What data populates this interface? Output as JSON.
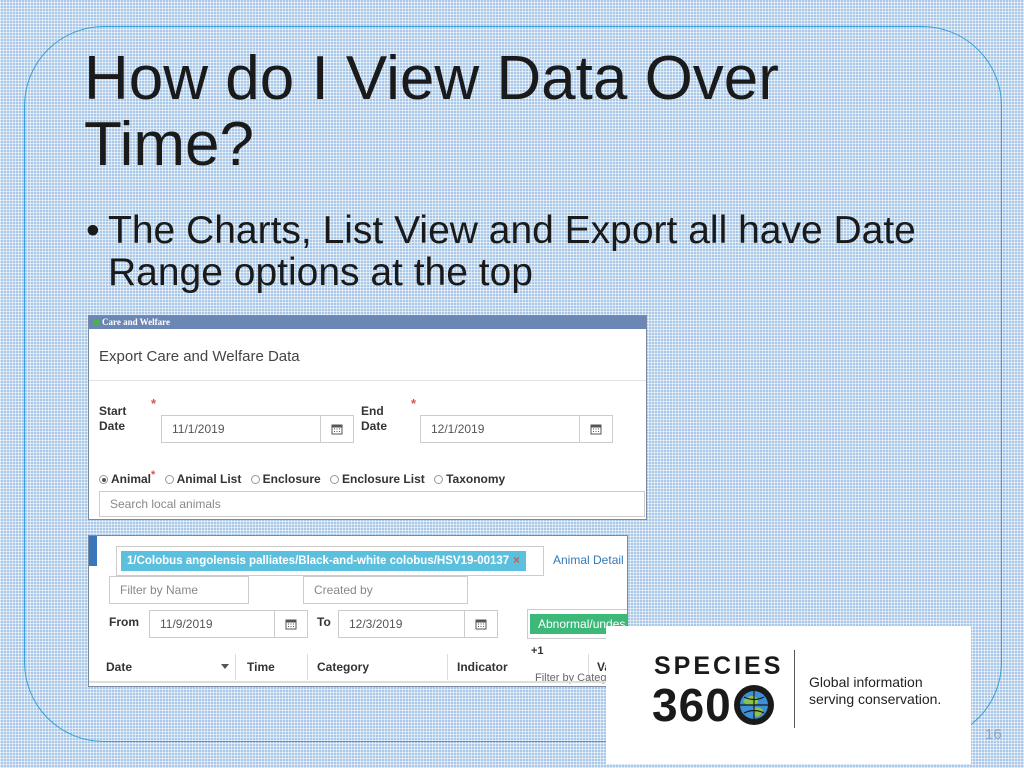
{
  "slide": {
    "title": "How do I View Data Over Time?",
    "bullet": "The Charts, List View and Export all have Date Range options at the top",
    "bullet_char": "•",
    "page_number": "16"
  },
  "export_panel": {
    "window_title": "Care and Welfare",
    "heading": "Export Care and Welfare Data",
    "start_label": "Start Date",
    "start_value": "11/1/2019",
    "end_label": "End Date",
    "end_value": "12/1/2019",
    "required_mark": "*",
    "radio_options": [
      "Animal",
      "Animal List",
      "Enclosure",
      "Enclosure List",
      "Taxonomy"
    ],
    "selected_radio": "Animal",
    "search_placeholder": "Search local animals"
  },
  "list_panel": {
    "animal_tag": "1/Colobus angolensis palliates/Black-and-white colobus/HSV19-00137",
    "tag_remove": "×",
    "animal_detail_link": "Animal Detail",
    "filter_name_placeholder": "Filter by Name",
    "created_by_placeholder": "Created by",
    "from_label": "From",
    "from_value": "11/9/2019",
    "to_label": "To",
    "to_value": "12/3/2019",
    "category_tag": "Abnormal/undes",
    "more_count": "+1",
    "columns": [
      "Date",
      "Time",
      "Category",
      "Indicator",
      "Value"
    ],
    "filter_category_placeholder": "Filter by Category"
  },
  "logo": {
    "line1": "SPECIES",
    "line2": "360",
    "tagline_1": "Global information",
    "tagline_2": "serving conservation."
  },
  "colors": {
    "frame": "#3aa0d8",
    "titlebar": "#6b87b5",
    "tag_blue": "#5bc0de",
    "tag_green": "#3cb878",
    "link": "#337ab7",
    "required": "#d9534f"
  }
}
